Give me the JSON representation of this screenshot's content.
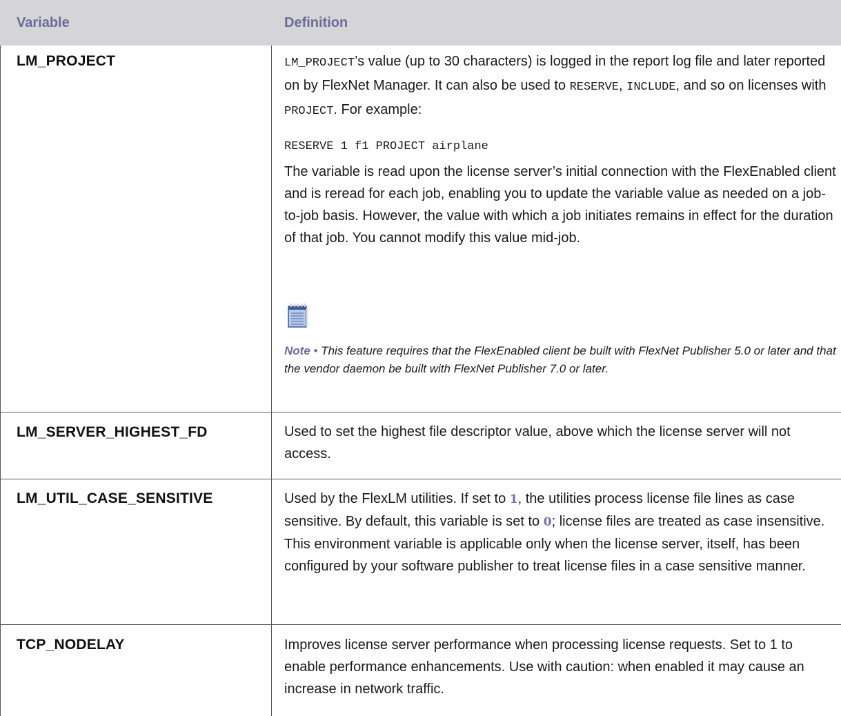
{
  "table": {
    "headers": {
      "variable": "Variable",
      "definition": "Definition"
    },
    "rows": [
      {
        "name": "LM_PROJECT",
        "p1": {
          "code1": "LM_PROJECT",
          "text1": "’s value (up to 30 characters) is logged in the report log file and later reported on by FlexNet Manager. It can also be used to ",
          "code2": "RESERVE",
          "sep1": ",",
          "code3": "INCLUDE",
          "text2": ", and so on licenses with ",
          "code4": "PROJECT",
          "text3": ". For example:"
        },
        "code_example": "RESERVE 1 f1 PROJECT airplane",
        "p2": "The variable is read upon the license server’s initial connection with the FlexEnabled client and is reread for each job, enabling you to update the variable value as needed on a job-to-job basis. However, the value with which a job initiates remains in effect for the duration of that job. You cannot modify this value mid-job.",
        "note": {
          "label": "Note",
          "bullet": "•",
          "text": "This feature requires that the FlexEnabled client be built with FlexNet Publisher 5.0 or later and that the vendor daemon be built with FlexNet Publisher 7.0 or later."
        }
      },
      {
        "name": "LM_SERVER_HIGHEST_FD",
        "definition": "Used to set the highest file descriptor value, above which the license server will not access."
      },
      {
        "name": "LM_UTIL_CASE_SENSITIVE",
        "def_a": "Used by the FlexLM utilities. If set to ",
        "val1": "1",
        "def_b": ", the utilities process license file lines as case sensitive. By default, this variable is set to ",
        "val0": "0",
        "def_c": "; license files are treated as case insensitive. This environment variable is applicable only when the license server, itself, has been configured by your software publisher to treat license files in a case sensitive manner."
      },
      {
        "name": "TCP_NODELAY",
        "definition": "Improves license server performance when processing license requests. Set to 1 to enable performance enhancements. Use with caution: when enabled it may cause an increase in network traffic."
      }
    ]
  },
  "icons": {
    "note": "note-document-icon"
  },
  "colors": {
    "header_bg": "#d5d5d8",
    "header_text": "#6b6b9a",
    "accent": "#7272a8"
  }
}
